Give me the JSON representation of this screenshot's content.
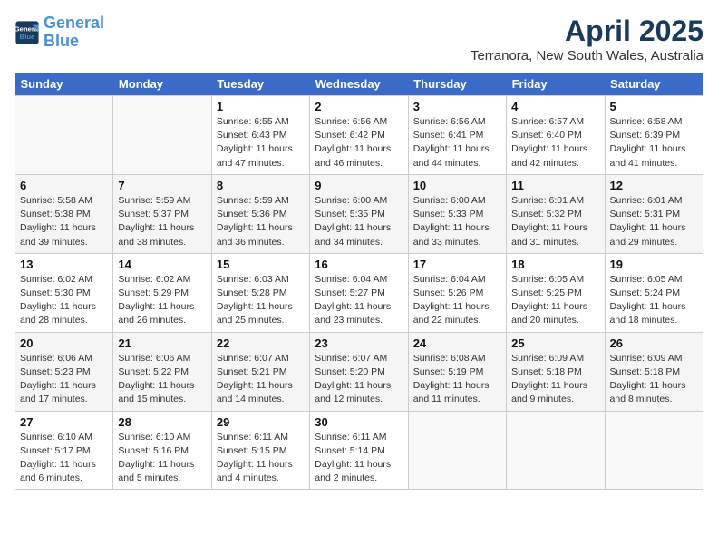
{
  "logo": {
    "line1": "General",
    "line2": "Blue"
  },
  "title": "April 2025",
  "location": "Terranora, New South Wales, Australia",
  "days_of_week": [
    "Sunday",
    "Monday",
    "Tuesday",
    "Wednesday",
    "Thursday",
    "Friday",
    "Saturday"
  ],
  "weeks": [
    [
      {
        "day": "",
        "info": ""
      },
      {
        "day": "",
        "info": ""
      },
      {
        "day": "1",
        "info": "Sunrise: 6:55 AM\nSunset: 6:43 PM\nDaylight: 11 hours\nand 47 minutes."
      },
      {
        "day": "2",
        "info": "Sunrise: 6:56 AM\nSunset: 6:42 PM\nDaylight: 11 hours\nand 46 minutes."
      },
      {
        "day": "3",
        "info": "Sunrise: 6:56 AM\nSunset: 6:41 PM\nDaylight: 11 hours\nand 44 minutes."
      },
      {
        "day": "4",
        "info": "Sunrise: 6:57 AM\nSunset: 6:40 PM\nDaylight: 11 hours\nand 42 minutes."
      },
      {
        "day": "5",
        "info": "Sunrise: 6:58 AM\nSunset: 6:39 PM\nDaylight: 11 hours\nand 41 minutes."
      }
    ],
    [
      {
        "day": "6",
        "info": "Sunrise: 5:58 AM\nSunset: 5:38 PM\nDaylight: 11 hours\nand 39 minutes."
      },
      {
        "day": "7",
        "info": "Sunrise: 5:59 AM\nSunset: 5:37 PM\nDaylight: 11 hours\nand 38 minutes."
      },
      {
        "day": "8",
        "info": "Sunrise: 5:59 AM\nSunset: 5:36 PM\nDaylight: 11 hours\nand 36 minutes."
      },
      {
        "day": "9",
        "info": "Sunrise: 6:00 AM\nSunset: 5:35 PM\nDaylight: 11 hours\nand 34 minutes."
      },
      {
        "day": "10",
        "info": "Sunrise: 6:00 AM\nSunset: 5:33 PM\nDaylight: 11 hours\nand 33 minutes."
      },
      {
        "day": "11",
        "info": "Sunrise: 6:01 AM\nSunset: 5:32 PM\nDaylight: 11 hours\nand 31 minutes."
      },
      {
        "day": "12",
        "info": "Sunrise: 6:01 AM\nSunset: 5:31 PM\nDaylight: 11 hours\nand 29 minutes."
      }
    ],
    [
      {
        "day": "13",
        "info": "Sunrise: 6:02 AM\nSunset: 5:30 PM\nDaylight: 11 hours\nand 28 minutes."
      },
      {
        "day": "14",
        "info": "Sunrise: 6:02 AM\nSunset: 5:29 PM\nDaylight: 11 hours\nand 26 minutes."
      },
      {
        "day": "15",
        "info": "Sunrise: 6:03 AM\nSunset: 5:28 PM\nDaylight: 11 hours\nand 25 minutes."
      },
      {
        "day": "16",
        "info": "Sunrise: 6:04 AM\nSunset: 5:27 PM\nDaylight: 11 hours\nand 23 minutes."
      },
      {
        "day": "17",
        "info": "Sunrise: 6:04 AM\nSunset: 5:26 PM\nDaylight: 11 hours\nand 22 minutes."
      },
      {
        "day": "18",
        "info": "Sunrise: 6:05 AM\nSunset: 5:25 PM\nDaylight: 11 hours\nand 20 minutes."
      },
      {
        "day": "19",
        "info": "Sunrise: 6:05 AM\nSunset: 5:24 PM\nDaylight: 11 hours\nand 18 minutes."
      }
    ],
    [
      {
        "day": "20",
        "info": "Sunrise: 6:06 AM\nSunset: 5:23 PM\nDaylight: 11 hours\nand 17 minutes."
      },
      {
        "day": "21",
        "info": "Sunrise: 6:06 AM\nSunset: 5:22 PM\nDaylight: 11 hours\nand 15 minutes."
      },
      {
        "day": "22",
        "info": "Sunrise: 6:07 AM\nSunset: 5:21 PM\nDaylight: 11 hours\nand 14 minutes."
      },
      {
        "day": "23",
        "info": "Sunrise: 6:07 AM\nSunset: 5:20 PM\nDaylight: 11 hours\nand 12 minutes."
      },
      {
        "day": "24",
        "info": "Sunrise: 6:08 AM\nSunset: 5:19 PM\nDaylight: 11 hours\nand 11 minutes."
      },
      {
        "day": "25",
        "info": "Sunrise: 6:09 AM\nSunset: 5:18 PM\nDaylight: 11 hours\nand 9 minutes."
      },
      {
        "day": "26",
        "info": "Sunrise: 6:09 AM\nSunset: 5:18 PM\nDaylight: 11 hours\nand 8 minutes."
      }
    ],
    [
      {
        "day": "27",
        "info": "Sunrise: 6:10 AM\nSunset: 5:17 PM\nDaylight: 11 hours\nand 6 minutes."
      },
      {
        "day": "28",
        "info": "Sunrise: 6:10 AM\nSunset: 5:16 PM\nDaylight: 11 hours\nand 5 minutes."
      },
      {
        "day": "29",
        "info": "Sunrise: 6:11 AM\nSunset: 5:15 PM\nDaylight: 11 hours\nand 4 minutes."
      },
      {
        "day": "30",
        "info": "Sunrise: 6:11 AM\nSunset: 5:14 PM\nDaylight: 11 hours\nand 2 minutes."
      },
      {
        "day": "",
        "info": ""
      },
      {
        "day": "",
        "info": ""
      },
      {
        "day": "",
        "info": ""
      }
    ]
  ]
}
